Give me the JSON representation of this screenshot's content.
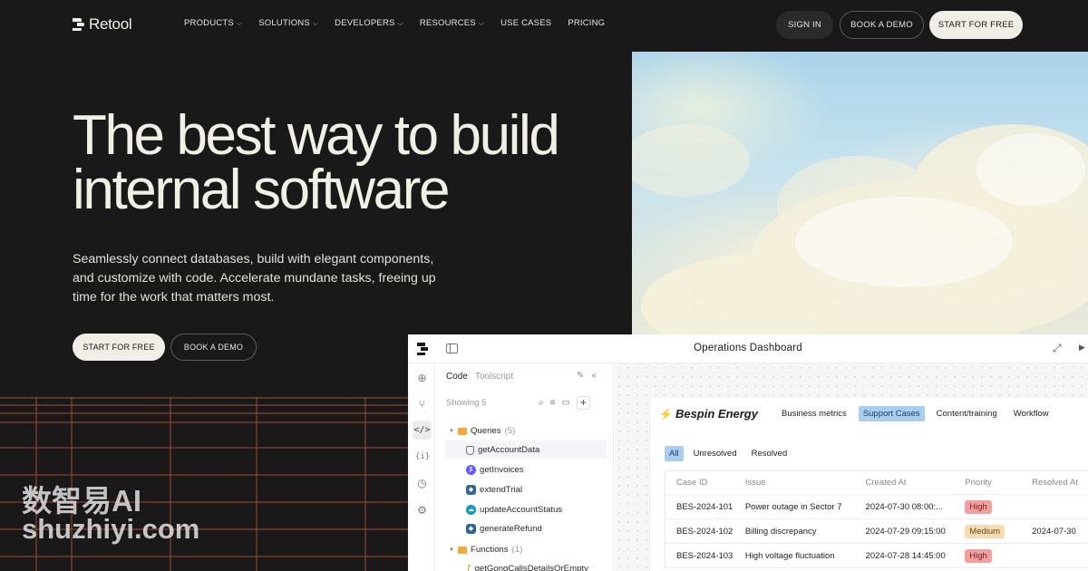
{
  "brand": {
    "name": "Retool"
  },
  "nav": {
    "menu": [
      {
        "label": "PRODUCTS",
        "has_dropdown": true
      },
      {
        "label": "SOLUTIONS",
        "has_dropdown": true
      },
      {
        "label": "DEVELOPERS",
        "has_dropdown": true
      },
      {
        "label": "RESOURCES",
        "has_dropdown": true
      },
      {
        "label": "USE CASES",
        "has_dropdown": false
      },
      {
        "label": "PRICING",
        "has_dropdown": false
      }
    ],
    "sign_in": "SIGN IN",
    "book_demo": "BOOK A DEMO",
    "start_free": "START FOR FREE"
  },
  "hero": {
    "title_line1": "The best way to build",
    "title_line2": "internal software",
    "subtitle_line1": "Seamlessly connect databases, build with elegant components,",
    "subtitle_line2": "and customize with code. Accelerate mundane tasks, freeing up",
    "subtitle_line3": "time for the work that matters most.",
    "start_free": "START FOR FREE",
    "book_demo": "BOOK A DEMO"
  },
  "app": {
    "title": "Operations Dashboard",
    "panel": {
      "tab_code": "Code",
      "tab_toolscript": "Toolscript",
      "showing": "Showing 5",
      "queries_folder": "Queries",
      "queries_count": "(5)",
      "queries": [
        {
          "name": "getAccountData",
          "icon": "database-icon"
        },
        {
          "name": "getInvoices",
          "icon": "stripe-icon"
        },
        {
          "name": "extendTrial",
          "icon": "postgres-icon"
        },
        {
          "name": "updateAccountStatus",
          "icon": "salesforce-icon"
        },
        {
          "name": "generateRefund",
          "icon": "postgres-icon"
        }
      ],
      "functions_folder": "Functions",
      "functions_count": "(1)",
      "functions": [
        {
          "name": "getGongCallsDetailsOrEmpty"
        }
      ]
    },
    "dashboard": {
      "brand": "Bespin Energy",
      "tabs": [
        "Business metrics",
        "Support Cases",
        "Content/training",
        "Workflow"
      ],
      "active_tab": "Support Cases",
      "filters": [
        "All",
        "Unresolved",
        "Resolved"
      ],
      "active_filter": "All",
      "columns": [
        "Case ID",
        "Issue",
        "Created At",
        "Priority",
        "Resolved At"
      ],
      "rows": [
        {
          "id": "BES-2024-101",
          "issue": "Power outage in Sector 7",
          "created": "2024-07-30 08:00:...",
          "priority": "High",
          "resolved": ""
        },
        {
          "id": "BES-2024-102",
          "issue": "Billing discrepancy",
          "created": "2024-07-29 09:15:00",
          "priority": "Medium",
          "resolved": "2024-07-30"
        },
        {
          "id": "BES-2024-103",
          "issue": "High voltage fluctuation",
          "created": "2024-07-28 14:45:00",
          "priority": "High",
          "resolved": ""
        }
      ]
    }
  },
  "watermark": {
    "line1": "数智易AI",
    "line2": "shuzhiyi.com"
  },
  "colors": {
    "background": "#1a1818",
    "text": "#f2efe7",
    "accent_button": "#f0eee6",
    "grid_lines": "#c8643c",
    "tab_active": "#a9cdf0",
    "priority_high": "#f2a0a0",
    "priority_medium": "#f5dcb3"
  }
}
